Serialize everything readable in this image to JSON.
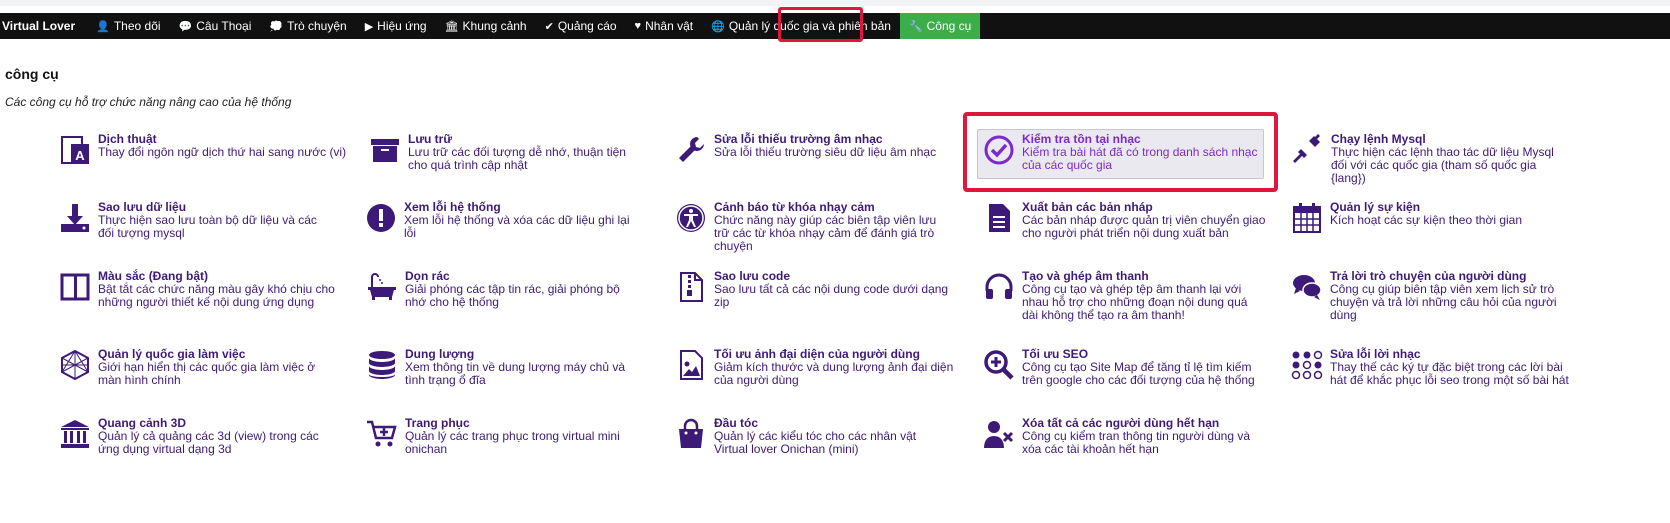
{
  "nav": {
    "brand": "Virtual Lover",
    "items": [
      {
        "label": "Theo dõi",
        "icon": "user-icon",
        "glyph": "👤"
      },
      {
        "label": "Câu Thoại",
        "icon": "chat-icon",
        "glyph": "💬"
      },
      {
        "label": "Trò chuyện",
        "icon": "comments-icon",
        "glyph": "💭"
      },
      {
        "label": "Hiệu ứng",
        "icon": "play-circle-icon",
        "glyph": "▶"
      },
      {
        "label": "Khung cảnh",
        "icon": "building-icon",
        "glyph": "🏛"
      },
      {
        "label": "Quảng cáo",
        "icon": "check-circle-icon",
        "glyph": "✔"
      },
      {
        "label": "Nhân vật",
        "icon": "heart-icon",
        "glyph": "♥"
      },
      {
        "label": "Quản lý quốc gia và phiên bản",
        "icon": "globe-icon",
        "glyph": "🌐"
      },
      {
        "label": "Công cụ",
        "icon": "wrench-icon",
        "glyph": "🔧"
      }
    ]
  },
  "page": {
    "title": "công cụ",
    "description": "Các công cụ hỗ trợ chức năng nâng cao của hệ thống"
  },
  "colors": {
    "accent": "#3cae49",
    "highlight": "#e0173c",
    "link": "#3d1a78",
    "selected_text": "#7a2bc9"
  },
  "tools": [
    {
      "title": "Dịch thuật",
      "desc": "Thay đổi ngôn ngữ dịch thứ hai sang nước (vi)",
      "icon": "translate-icon"
    },
    {
      "title": "Lưu trữ",
      "desc": "Lưu trữ các đối tượng dễ nhớ, thuận tiện cho quá trình cập nhật",
      "icon": "archive-icon"
    },
    {
      "title": "Sửa lỗi thiếu trường âm nhạc",
      "desc": "Sửa lỗi thiếu trường siêu dữ liệu âm nhạc",
      "icon": "wrench-icon"
    },
    {
      "title": "Kiểm tra tồn tại nhạc",
      "desc": "Kiểm tra bài hát đã có trong danh sách nhạc của các quốc gia",
      "icon": "check-circle-icon"
    },
    {
      "title": "Chạy lệnh Mysql",
      "desc": "Thực hiện các lệnh thao tác dữ liệu Mysql đối với các quốc gia (tham số quốc gia {lang})",
      "icon": "plug-icon"
    },
    {
      "title": "Sao lưu dữ liệu",
      "desc": "Thực hiện sao lưu toàn bộ dữ liệu và các đối tượng mysql",
      "icon": "download-icon"
    },
    {
      "title": "Xem lỗi hệ thống",
      "desc": "Xem lỗi hệ thống và xóa các dữ liệu ghi lại lỗi",
      "icon": "exclamation-circle-icon"
    },
    {
      "title": "Cảnh báo từ khóa nhạy cảm",
      "desc": "Chức năng này giúp các biên tập viên lưu trữ các từ khóa nhạy cảm để đánh giá trò chuyện",
      "icon": "accessibility-icon"
    },
    {
      "title": "Xuất bản các bản nháp",
      "desc": "Các bản nháp được quản trị viên chuyển giao cho người phát triển nội dung xuất bản",
      "icon": "file-text-icon"
    },
    {
      "title": "Quản lý sự kiện",
      "desc": "Kích hoạt các sự kiện theo thời gian",
      "icon": "calendar-icon"
    },
    {
      "title": "Màu sắc (Đang bật)",
      "desc": "Bật tắt các chức năng màu gây khó chịu cho những người thiết kế nội dung ứng dụng",
      "icon": "columns-icon"
    },
    {
      "title": "Dọn rác",
      "desc": "Giải phóng các tập tin rác, giải phóng bộ nhớ cho hệ thống",
      "icon": "bath-icon"
    },
    {
      "title": "Sao lưu code",
      "desc": "Sao lưu tất cả các nội dung code dưới dạng zip",
      "icon": "file-zip-icon"
    },
    {
      "title": "Tạo và ghép âm thanh",
      "desc": "Công cụ tạo và ghép tệp âm thanh lại với nhau hỗ trợ cho những đoạn nội dung quá dài không thể tạo ra âm thanh!",
      "icon": "headphones-icon"
    },
    {
      "title": "Trả lời trò chuyện của người dùng",
      "desc": "Công cụ giúp biên tập viên xem lịch sử trò chuyện và trả lời những câu hỏi của người dùng",
      "icon": "comments-icon"
    },
    {
      "title": "Quản lý quốc gia làm việc",
      "desc": "Giới hạn hiển thị các quốc gia làm việc ở màn hình chính",
      "icon": "hexagon-icon"
    },
    {
      "title": "Dung lượng",
      "desc": "Xem thông tin về dung lượng máy chủ và tình trạng ổ đĩa",
      "icon": "database-icon"
    },
    {
      "title": "Tối ưu ảnh đại diện của người dùng",
      "desc": "Giảm kích thước và dung lượng ảnh đại diện của người dùng",
      "icon": "file-image-icon"
    },
    {
      "title": "Tối ưu SEO",
      "desc": "Công cụ tạo Site Map để tăng tỉ lệ tìm kiếm trên google cho các đối tượng của hệ thống",
      "icon": "search-plus-icon"
    },
    {
      "title": "Sửa lỗi lời nhạc",
      "desc": "Thay thế các ký tự đặc biệt trong các lời bài hát để khắc phục lỗi seo trong một số bài hát",
      "icon": "dots-grid-icon"
    },
    {
      "title": "Quang cảnh 3D",
      "desc": "Quản lý cả quảng các 3d (view) trong các ứng dụng virtual dạng 3d",
      "icon": "bank-icon"
    },
    {
      "title": "Trang phục",
      "desc": "Quản lý các trang phục trong virtual mini onichan",
      "icon": "cart-plus-icon"
    },
    {
      "title": "Đầu tóc",
      "desc": "Quản lý các kiểu tóc cho các nhân vật Virtual lover Onichan (mini)",
      "icon": "shopping-bag-icon"
    },
    {
      "title": "Xóa tất cả các người dùng hết hạn",
      "desc": "Công cụ kiểm tran thông tin người dùng và xóa các tài khoản hết hạn",
      "icon": "user-times-icon"
    }
  ]
}
